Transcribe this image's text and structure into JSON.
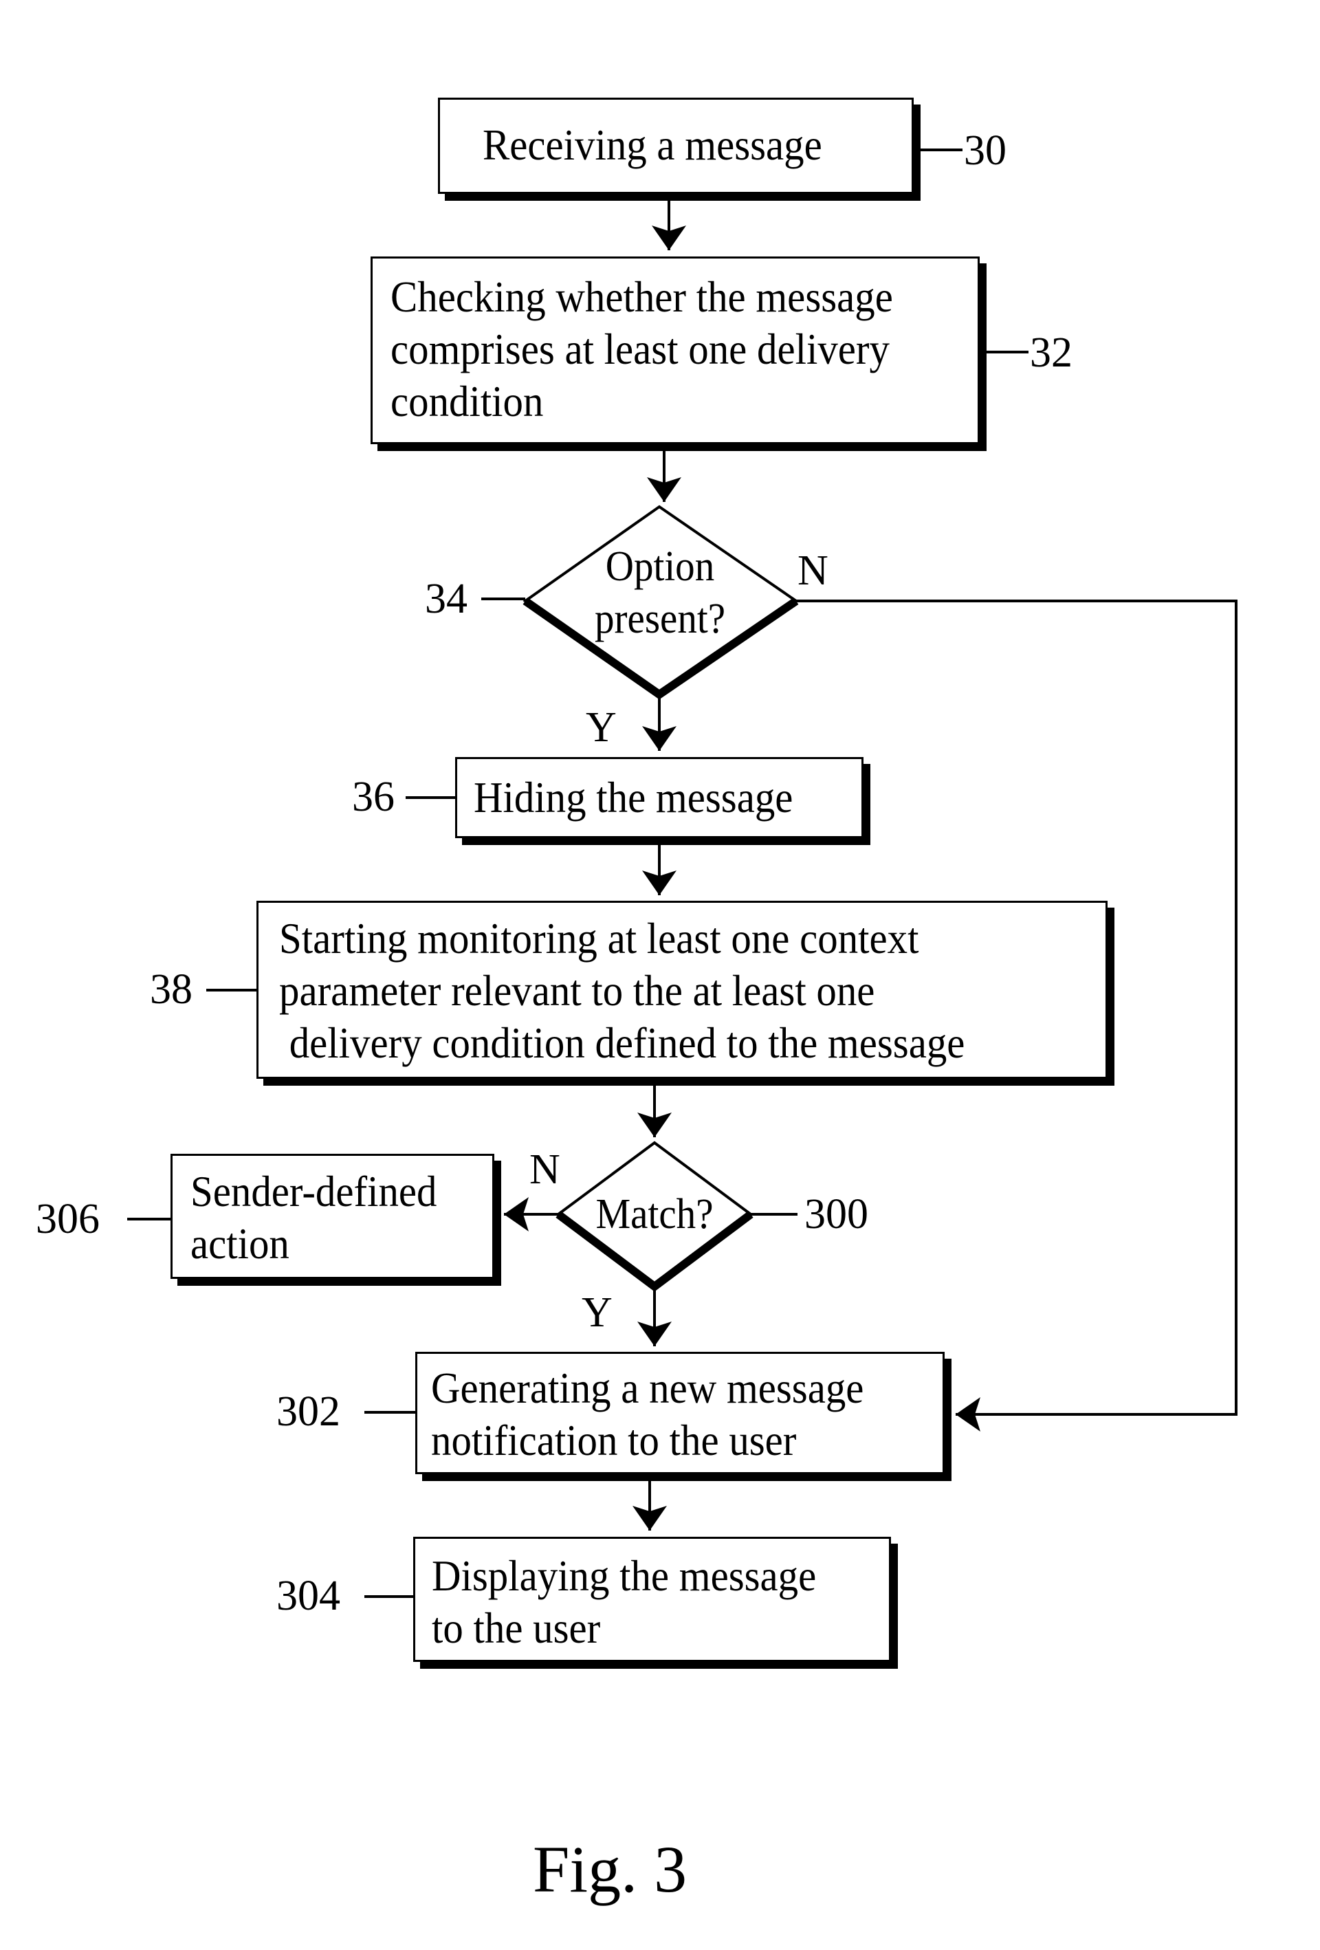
{
  "figure": {
    "caption": "Fig. 3",
    "nodes": [
      {
        "id": "30",
        "type": "process",
        "text": "Receiving a message",
        "ref": "30"
      },
      {
        "id": "32",
        "type": "process",
        "text": "Checking whether the message\ncomprises at least one delivery\ncondition",
        "ref": "32"
      },
      {
        "id": "34",
        "type": "decision",
        "text": "Option\npresent?",
        "ref": "34"
      },
      {
        "id": "36",
        "type": "process",
        "text": "Hiding the message",
        "ref": "36"
      },
      {
        "id": "38",
        "type": "process",
        "text": "Starting monitoring at least one context\nparameter relevant to the at least one\n delivery condition defined to the message",
        "ref": "38"
      },
      {
        "id": "300",
        "type": "decision",
        "text": "Match?",
        "ref": "300"
      },
      {
        "id": "306",
        "type": "process",
        "text": "Sender-defined\naction",
        "ref": "306"
      },
      {
        "id": "302",
        "type": "process",
        "text": "Generating a new message\nnotification to the user",
        "ref": "302"
      },
      {
        "id": "304",
        "type": "process",
        "text": "Displaying the message\nto the user",
        "ref": "304"
      }
    ],
    "edges": [
      {
        "from": "30",
        "to": "32",
        "label": ""
      },
      {
        "from": "32",
        "to": "34",
        "label": ""
      },
      {
        "from": "34",
        "to": "36",
        "label": "Y"
      },
      {
        "from": "34",
        "to": "302",
        "label": "N"
      },
      {
        "from": "36",
        "to": "38",
        "label": ""
      },
      {
        "from": "38",
        "to": "300",
        "label": ""
      },
      {
        "from": "300",
        "to": "306",
        "label": "N"
      },
      {
        "from": "300",
        "to": "302",
        "label": "Y"
      },
      {
        "from": "302",
        "to": "304",
        "label": ""
      }
    ]
  },
  "labels": {
    "yes": "Y",
    "no": "N"
  }
}
